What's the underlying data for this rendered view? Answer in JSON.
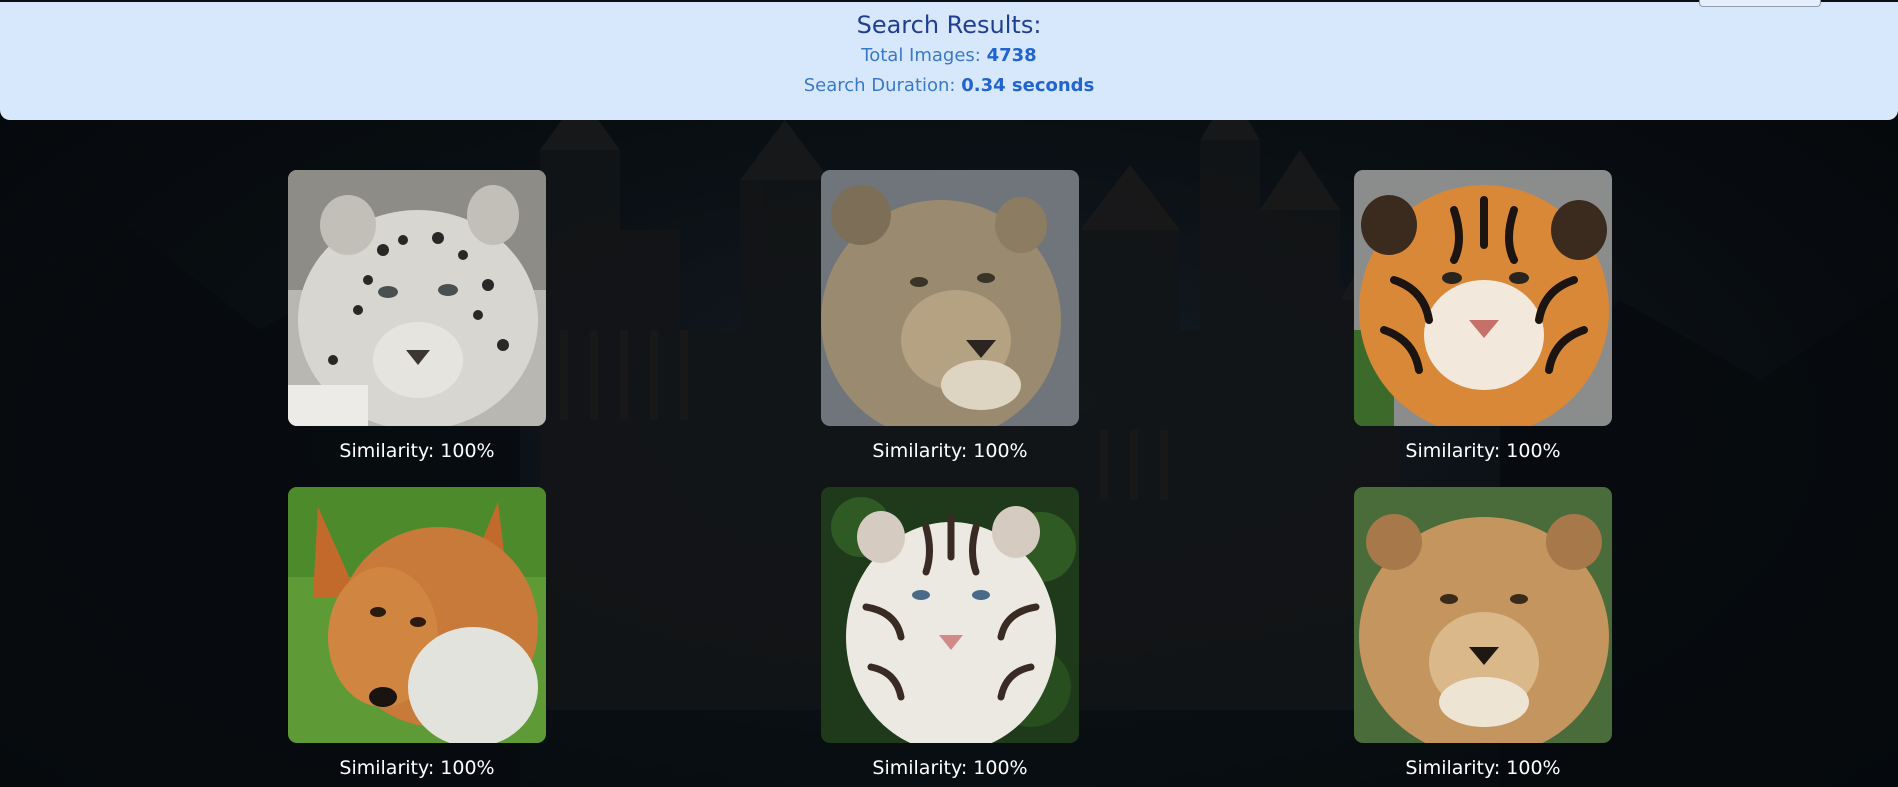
{
  "header": {
    "title": "Search Results:",
    "total_label": "Total Images:",
    "total_value": "4738",
    "duration_label": "Search Duration:",
    "duration_value": "0.34 seconds"
  },
  "results": [
    {
      "subject": "snow leopard",
      "similarity": "Similarity: 100%"
    },
    {
      "subject": "lioness",
      "similarity": "Similarity: 100%"
    },
    {
      "subject": "bengal tiger",
      "similarity": "Similarity: 100%"
    },
    {
      "subject": "red fox",
      "similarity": "Similarity: 100%"
    },
    {
      "subject": "white tiger",
      "similarity": "Similarity: 100%"
    },
    {
      "subject": "lioness",
      "similarity": "Similarity: 100%"
    }
  ],
  "colors": {
    "header_bg": "#d8e8fc",
    "title": "#1f3f91",
    "label": "#3a79c9",
    "value": "#2264cf",
    "page_bg": "#0d141b"
  }
}
